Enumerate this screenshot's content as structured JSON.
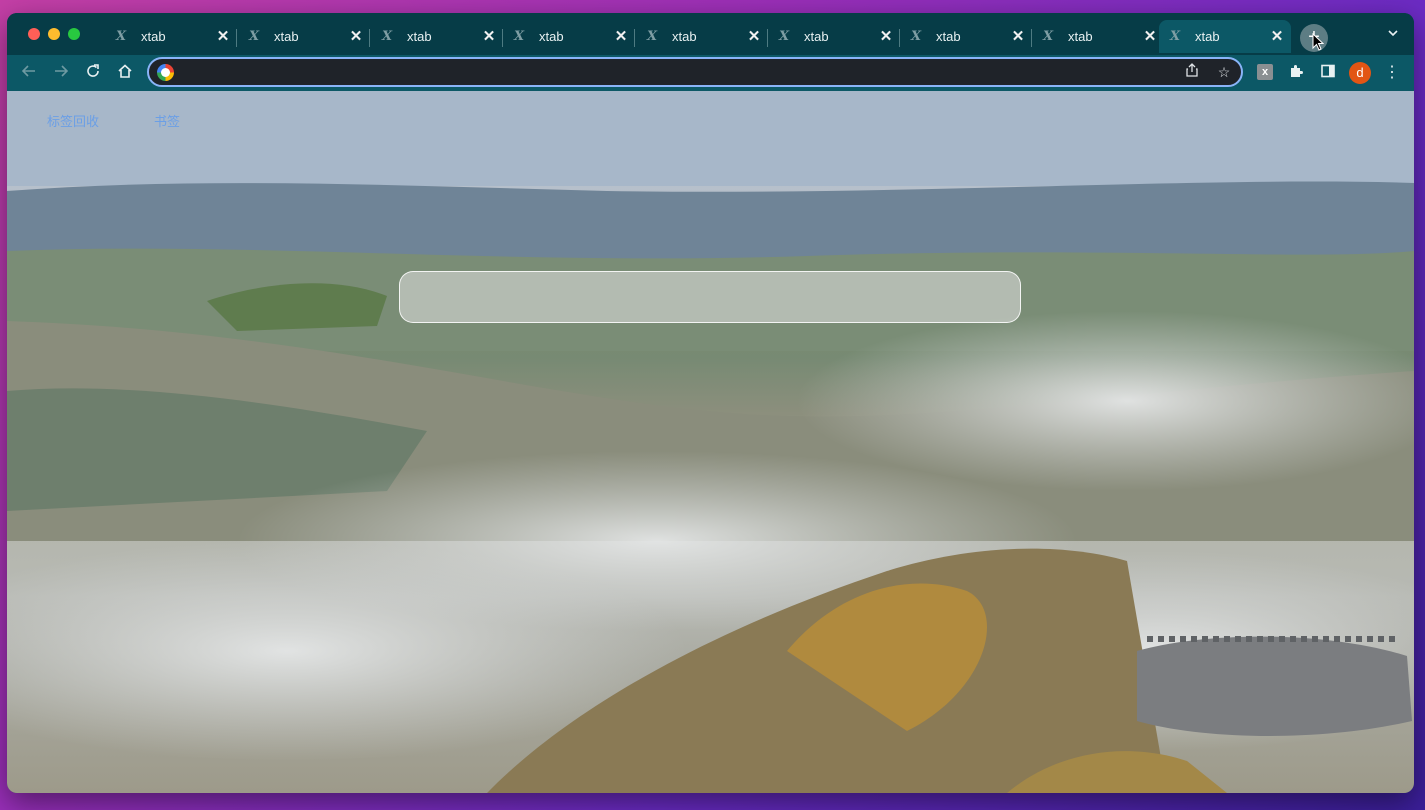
{
  "tabs": [
    {
      "title": "xtab",
      "favicon": "X",
      "active": false
    },
    {
      "title": "xtab",
      "favicon": "X",
      "active": false
    },
    {
      "title": "xtab",
      "favicon": "X",
      "active": false
    },
    {
      "title": "xtab",
      "favicon": "X",
      "active": false
    },
    {
      "title": "xtab",
      "favicon": "X",
      "active": false
    },
    {
      "title": "xtab",
      "favicon": "X",
      "active": false
    },
    {
      "title": "xtab",
      "favicon": "X",
      "active": false
    },
    {
      "title": "xtab",
      "favicon": "X",
      "active": false
    },
    {
      "title": "xtab",
      "favicon": "X",
      "active": true
    }
  ],
  "toolbar": {
    "address_value": "",
    "extension_label": "x",
    "profile_initial": "d"
  },
  "page": {
    "nav_links": [
      "标签回收",
      "书签"
    ],
    "search_value": "",
    "search_placeholder": ""
  },
  "icons": {
    "back": "arrow-left-icon",
    "forward": "arrow-right-icon",
    "reload": "reload-icon",
    "home": "home-icon",
    "share": "share-icon",
    "star": "star-icon",
    "extensions": "puzzle-icon",
    "sidepanel": "side-panel-icon",
    "menu": "kebab-menu-icon"
  },
  "colors": {
    "tabstrip": "#063c47",
    "toolbar": "#0c5866",
    "omnibox_border": "#8ab4f8",
    "link": "#6b9fe6",
    "avatar": "#e25514"
  }
}
